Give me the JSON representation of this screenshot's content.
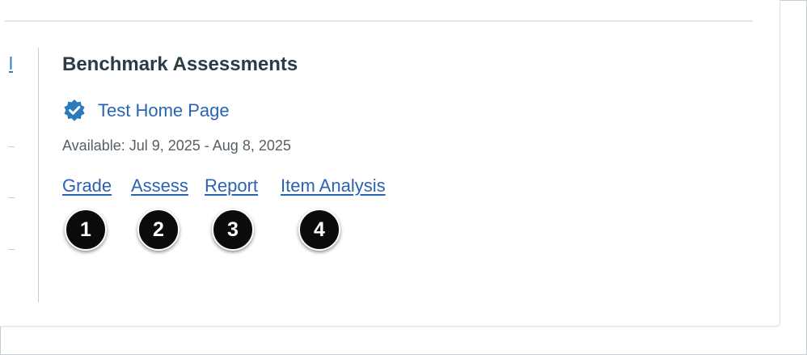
{
  "sidebar": {
    "link_fragment": "l"
  },
  "section": {
    "title": "Benchmark Assessments"
  },
  "item": {
    "badge_icon": "verified-badge-icon",
    "link_label": "Test Home Page",
    "availability": "Available: Jul 9, 2025 - Aug 8, 2025"
  },
  "actions": {
    "grade": "Grade",
    "assess": "Assess",
    "report": "Report",
    "item_analysis": "Item Analysis"
  },
  "callouts": [
    "1",
    "2",
    "3",
    "4"
  ],
  "colors": {
    "link": "#2b63b3",
    "title": "#2d3b45",
    "muted_text": "#555f66",
    "badge": "#2b7abc",
    "callout_bg": "#0b0b0b"
  }
}
